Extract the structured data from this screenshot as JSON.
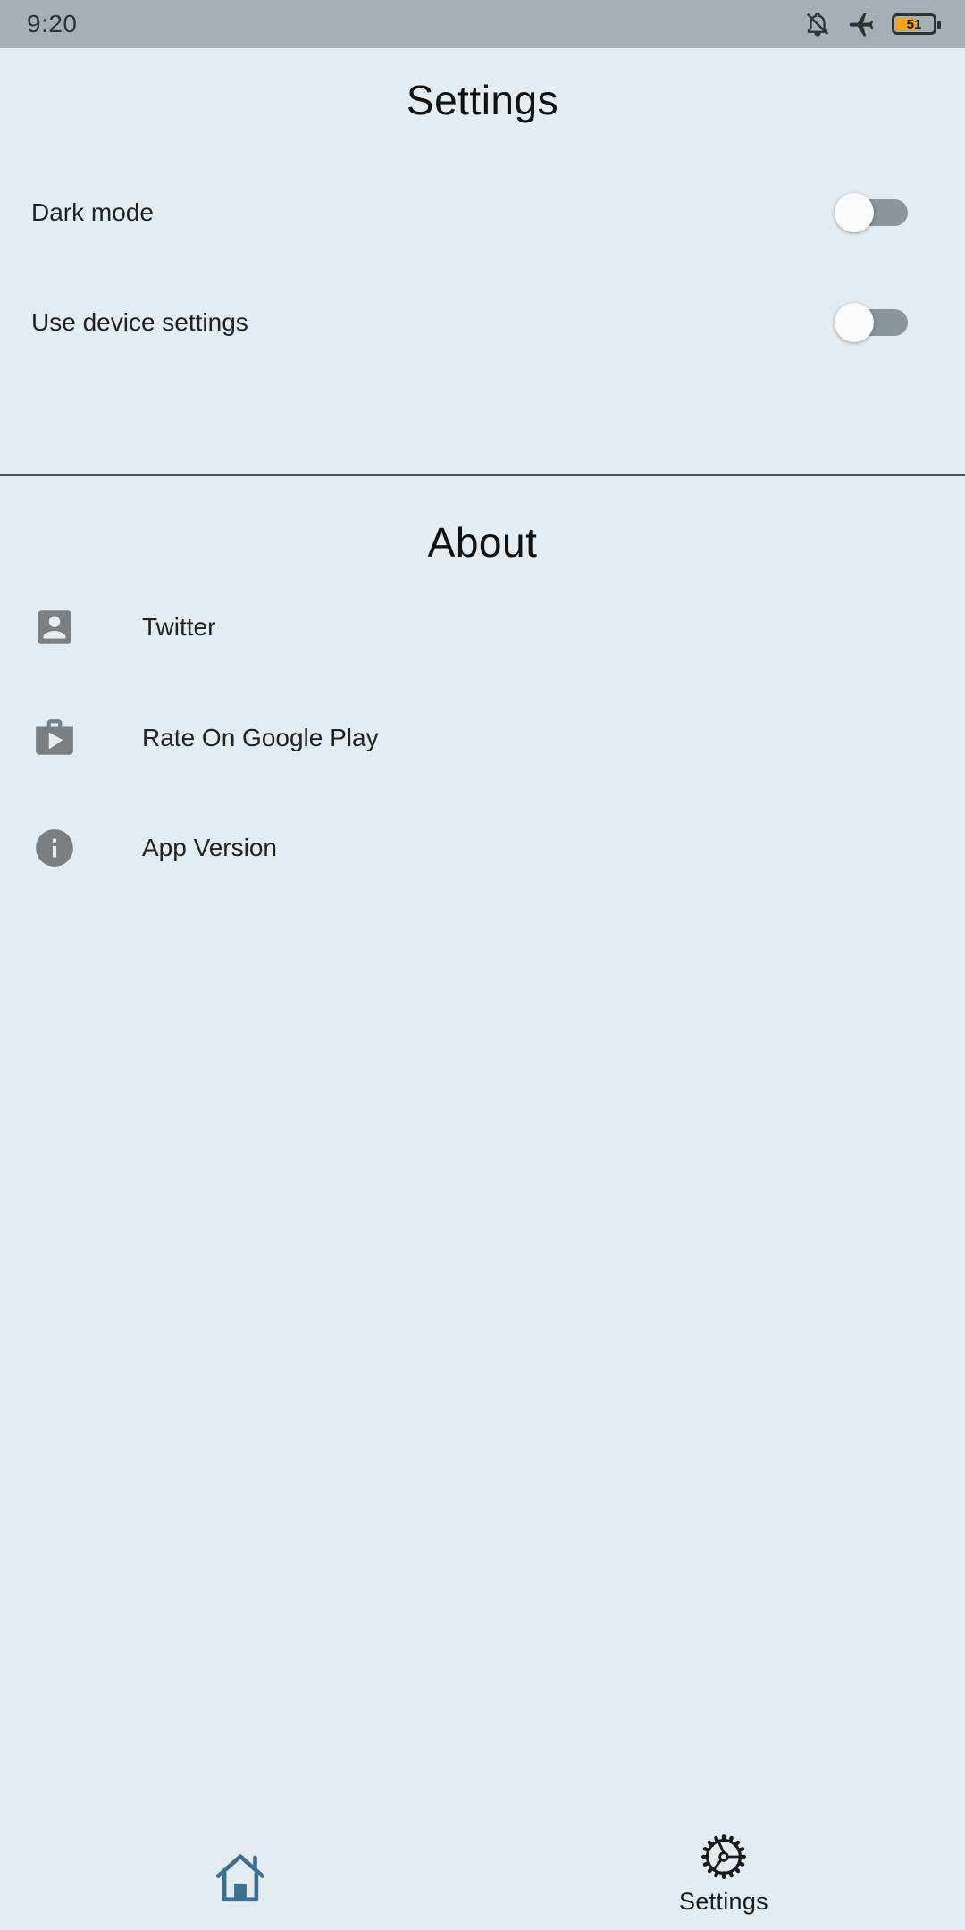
{
  "status_bar": {
    "time": "9:20",
    "battery_level": "51",
    "battery_percent": 51,
    "icons": [
      "bell-off-icon",
      "airplane-icon",
      "battery-icon"
    ]
  },
  "settings": {
    "title": "Settings",
    "dark_mode": {
      "label": "Dark mode",
      "enabled": false
    },
    "device_settings": {
      "label": "Use device settings",
      "enabled": false
    }
  },
  "about": {
    "title": "About",
    "items": [
      {
        "label": "Twitter",
        "icon": "account-box-icon"
      },
      {
        "label": "Rate On Google Play",
        "icon": "shop-icon"
      },
      {
        "label": "App Version",
        "icon": "info-icon"
      }
    ]
  },
  "bottom_nav": {
    "items": [
      {
        "label": "",
        "icon": "home-icon",
        "active": false
      },
      {
        "label": "Settings",
        "icon": "settings-icon",
        "active": true
      }
    ]
  },
  "colors": {
    "background": "#e4ecf1",
    "status_bar": "#a6afb4",
    "switch_track_off": "#8c959a",
    "icon_grey": "#7b7f82",
    "home_icon": "#3f6f8e",
    "battery": "#f2a51c"
  }
}
